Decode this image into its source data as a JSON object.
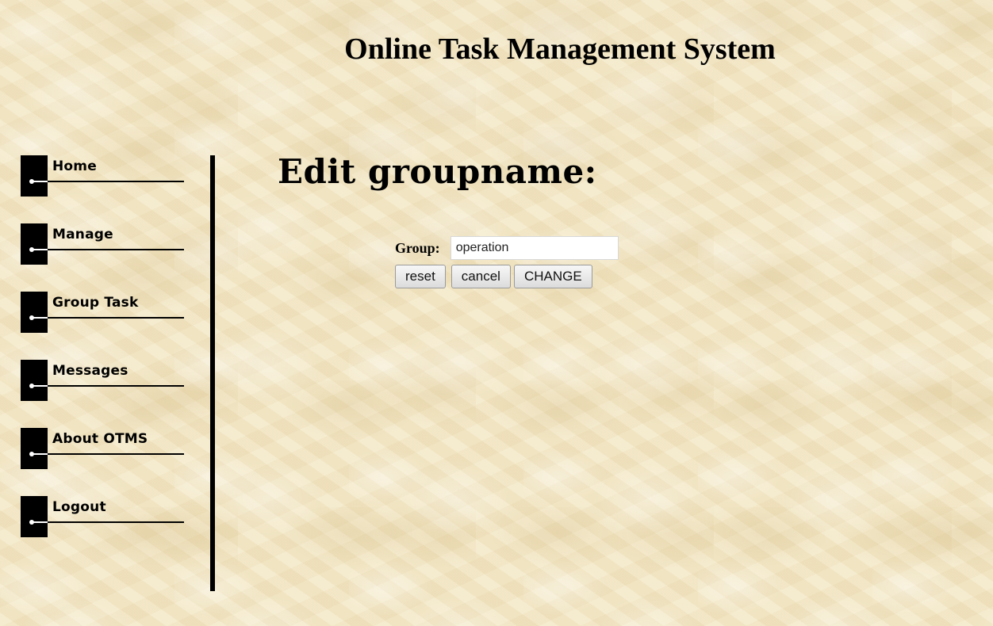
{
  "site_title": "Online Task Management System",
  "sidebar": {
    "items": [
      {
        "label": "Home"
      },
      {
        "label": "Manage"
      },
      {
        "label": "Group Task"
      },
      {
        "label": "Messages"
      },
      {
        "label": "About OTMS"
      },
      {
        "label": "Logout"
      }
    ]
  },
  "main": {
    "heading": "Edit groupname:",
    "form": {
      "group_label": "Group:",
      "group_value": "operation",
      "buttons": {
        "reset": "reset",
        "cancel": "cancel",
        "change": "CHANGE"
      }
    }
  }
}
